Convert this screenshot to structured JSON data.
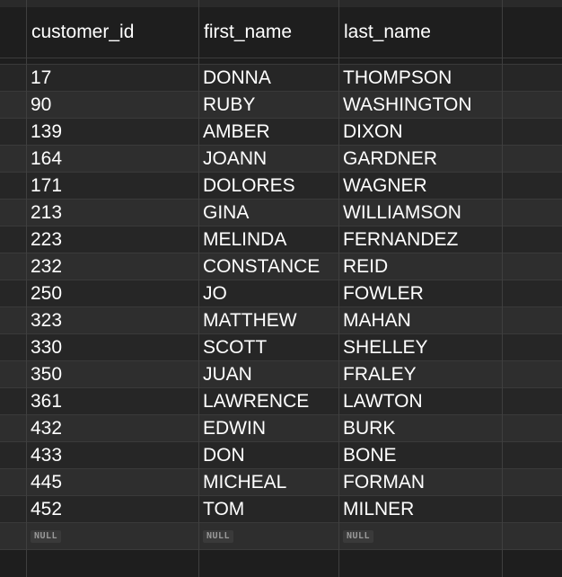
{
  "table": {
    "columns": [
      {
        "label": "customer_id"
      },
      {
        "label": "first_name"
      },
      {
        "label": "last_name"
      }
    ],
    "rows": [
      [
        "17",
        "DONNA",
        "THOMPSON"
      ],
      [
        "90",
        "RUBY",
        "WASHINGTON"
      ],
      [
        "139",
        "AMBER",
        "DIXON"
      ],
      [
        "164",
        "JOANN",
        "GARDNER"
      ],
      [
        "171",
        "DOLORES",
        "WAGNER"
      ],
      [
        "213",
        "GINA",
        "WILLIAMSON"
      ],
      [
        "223",
        "MELINDA",
        "FERNANDEZ"
      ],
      [
        "232",
        "CONSTANCE",
        "REID"
      ],
      [
        "250",
        "JO",
        "FOWLER"
      ],
      [
        "323",
        "MATTHEW",
        "MAHAN"
      ],
      [
        "330",
        "SCOTT",
        "SHELLEY"
      ],
      [
        "350",
        "JUAN",
        "FRALEY"
      ],
      [
        "361",
        "LAWRENCE",
        "LAWTON"
      ],
      [
        "432",
        "EDWIN",
        "BURK"
      ],
      [
        "433",
        "DON",
        "BONE"
      ],
      [
        "445",
        "MICHEAL",
        "FORMAN"
      ],
      [
        "452",
        "TOM",
        "MILNER"
      ]
    ],
    "null_row": [
      "NULL",
      "NULL",
      "NULL"
    ]
  },
  "colors": {
    "background": "#1e1e1e",
    "row_odd": "#262626",
    "row_even": "#2e2e2e",
    "text": "#ffffff",
    "grid_line": "#3f3f3f"
  }
}
